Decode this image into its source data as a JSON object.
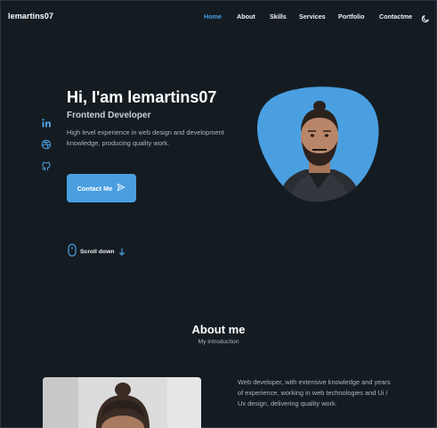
{
  "header": {
    "logo": "lemartins07",
    "nav": [
      {
        "label": "Home",
        "active": true
      },
      {
        "label": "About",
        "active": false
      },
      {
        "label": "Skills",
        "active": false
      },
      {
        "label": "Services",
        "active": false
      },
      {
        "label": "Portfolio",
        "active": false
      },
      {
        "label": "Contactme",
        "active": false
      }
    ],
    "theme_icon": "moon-icon"
  },
  "social": [
    "linkedin-icon",
    "dribbble-icon",
    "github-icon"
  ],
  "hero": {
    "title": "Hi, I'am lemartins07",
    "subtitle": "Frontend Developer",
    "description": "High level experience in web design and development knowledge, producing quality work.",
    "contact_label": "Contact Me",
    "scroll_label": "Scroll down"
  },
  "about": {
    "title": "About me",
    "subtitle": "My introduction",
    "text": "Web developer, with extensive knowledge and years of experience, working in web technologies and Ui / Ux design, delivering quality work."
  },
  "colors": {
    "background": "#141c22",
    "accent": "#4a9fe0",
    "text": "#ffffff",
    "muted": "#aeb6bd"
  }
}
